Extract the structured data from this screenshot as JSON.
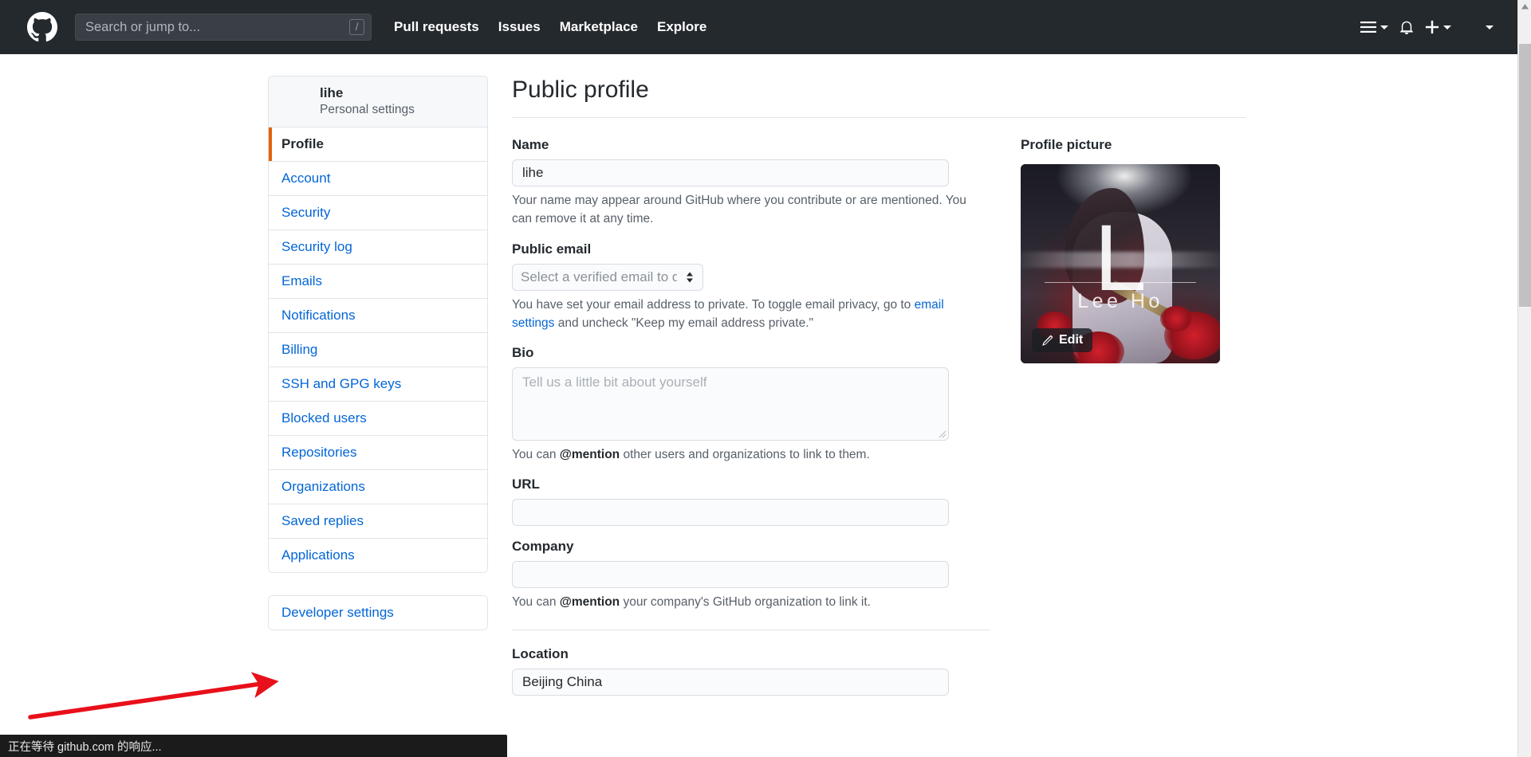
{
  "header": {
    "logo_icon": "github-mark-icon",
    "search": {
      "placeholder": "Search or jump to...",
      "value": "",
      "shortcut_badge": "/"
    },
    "nav": [
      {
        "label": "Pull requests"
      },
      {
        "label": "Issues"
      },
      {
        "label": "Marketplace"
      },
      {
        "label": "Explore"
      }
    ],
    "actions": [
      {
        "name": "global-menu-button",
        "icon": "hamburger-icon",
        "has_caret": true
      },
      {
        "name": "notifications-button",
        "icon": "bell-icon",
        "has_caret": false
      },
      {
        "name": "create-new-button",
        "icon": "plus-icon",
        "has_caret": true
      },
      {
        "name": "account-menu-button",
        "icon": "avatar-icon",
        "has_caret": true
      }
    ]
  },
  "sidebar": {
    "user": {
      "name": "lihe",
      "subtitle": "Personal settings",
      "avatar_icon": "user-avatar"
    },
    "items": [
      {
        "label": "Profile",
        "selected": true
      },
      {
        "label": "Account",
        "selected": false
      },
      {
        "label": "Security",
        "selected": false
      },
      {
        "label": "Security log",
        "selected": false
      },
      {
        "label": "Emails",
        "selected": false
      },
      {
        "label": "Notifications",
        "selected": false
      },
      {
        "label": "Billing",
        "selected": false
      },
      {
        "label": "SSH and GPG keys",
        "selected": false
      },
      {
        "label": "Blocked users",
        "selected": false
      },
      {
        "label": "Repositories",
        "selected": false
      },
      {
        "label": "Organizations",
        "selected": false
      },
      {
        "label": "Saved replies",
        "selected": false
      },
      {
        "label": "Applications",
        "selected": false
      }
    ],
    "developer_settings": {
      "label": "Developer settings"
    }
  },
  "main": {
    "title": "Public profile",
    "name_field": {
      "label": "Name",
      "value": "lihe",
      "hint": "Your name may appear around GitHub where you contribute or are mentioned. You can remove it at any time."
    },
    "public_email": {
      "label": "Public email",
      "selected_option": "Select a verified email to display",
      "hint_before": "You have set your email address to private. To toggle email privacy, go to ",
      "hint_link": "email settings",
      "hint_after": " and uncheck \"Keep my email address private.\""
    },
    "bio": {
      "label": "Bio",
      "value": "",
      "placeholder": "Tell us a little bit about yourself",
      "hint_before": "You can ",
      "hint_bold": "@mention",
      "hint_after": " other users and organizations to link to them."
    },
    "url": {
      "label": "URL",
      "value": "",
      "placeholder": ""
    },
    "company": {
      "label": "Company",
      "value": "",
      "placeholder": "",
      "hint_before": "You can ",
      "hint_bold": "@mention",
      "hint_after": " your company's GitHub organization to link it."
    },
    "location": {
      "label": "Location",
      "value": "Beijing China"
    }
  },
  "profile_picture": {
    "label": "Profile picture",
    "edit_label": "Edit",
    "edit_icon": "pencil-icon",
    "image_overlay_initial": "L",
    "image_overlay_name": "Lee Ho"
  },
  "annotation": {
    "arrow_icon": "red-arrow-icon",
    "color": "#e8101a",
    "points_to": "Developer settings"
  },
  "scrollbar": {
    "up_arrow_icon": "chevron-up-icon"
  },
  "statusbar": {
    "text": "正在等待 github.com 的响应..."
  },
  "colors": {
    "header_bg": "#24292e",
    "link": "#0366d6",
    "selected_marker": "#e36209",
    "text": "#24292e",
    "muted_text": "#586069",
    "border": "#e1e4e8",
    "input_bg": "#fafbfc"
  }
}
